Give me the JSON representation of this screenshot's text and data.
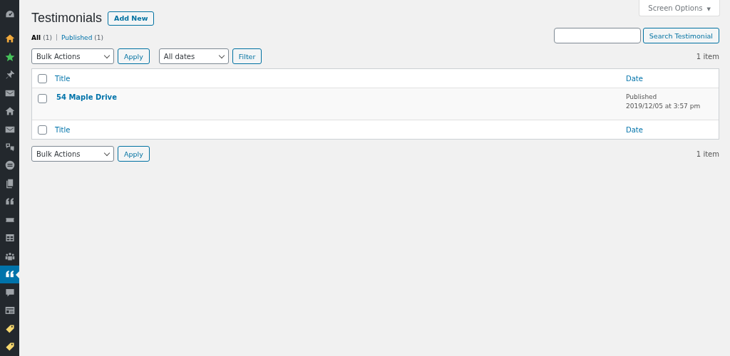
{
  "sidebar": {
    "items": [
      {
        "kind": "dashboard",
        "selected": false
      },
      {
        "kind": "home",
        "color": "#f0a93c",
        "selected": false
      },
      {
        "kind": "star",
        "color": "#46c35a",
        "selected": false
      },
      {
        "kind": "pin",
        "selected": false
      },
      {
        "kind": "mail",
        "selected": false
      },
      {
        "kind": "home",
        "selected": false
      },
      {
        "kind": "mail",
        "selected": false
      },
      {
        "kind": "translate",
        "selected": false
      },
      {
        "kind": "disc",
        "selected": false
      },
      {
        "kind": "copy",
        "selected": false
      },
      {
        "kind": "quote",
        "selected": false
      },
      {
        "kind": "ticket",
        "selected": false
      },
      {
        "kind": "table",
        "selected": false
      },
      {
        "kind": "group",
        "selected": false
      },
      {
        "kind": "quote",
        "selected": true
      },
      {
        "kind": "comment",
        "selected": false
      },
      {
        "kind": "card",
        "selected": false
      },
      {
        "kind": "tag",
        "color": "#f5d76e",
        "selected": false
      },
      {
        "kind": "tag",
        "color": "#f5d76e",
        "selected": false
      }
    ]
  },
  "screen_options": {
    "label": "Screen Options",
    "caret": "▼"
  },
  "heading": {
    "title": "Testimonials",
    "add_new": "Add New"
  },
  "views": [
    {
      "label": "All",
      "count": "(1)",
      "selected": true
    },
    {
      "label": "Published",
      "count": "(1)",
      "selected": false
    }
  ],
  "search": {
    "button": "Search Testimonial"
  },
  "top_actions": {
    "bulk": "Bulk Actions",
    "apply": "Apply",
    "dates": "All dates",
    "filter": "Filter",
    "count": "1 item"
  },
  "table": {
    "header": {
      "title": "Title",
      "date": "Date",
      "checked": false
    },
    "rows": [
      {
        "title": "54 Maple Drive",
        "status": "Published",
        "date": "2019/12/05 at 3:57 pm",
        "checked": false
      }
    ],
    "footer": {
      "title": "Title",
      "date": "Date",
      "checked": false
    }
  },
  "bottom_actions": {
    "bulk": "Bulk Actions",
    "apply": "Apply",
    "count": "1 item"
  }
}
